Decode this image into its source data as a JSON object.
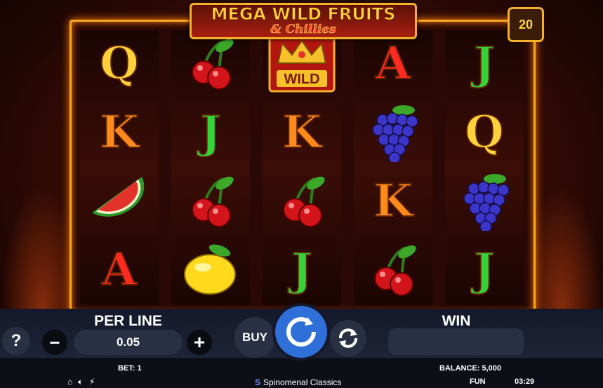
{
  "game": {
    "title_line1": "MEGA WILD FRUITS",
    "title_line2": "& Chillies",
    "lines_count": "20"
  },
  "reels": [
    [
      "Q",
      "K",
      "watermelon",
      "A"
    ],
    [
      "cherry",
      "J",
      "cherry",
      "lemon"
    ],
    [
      "wild",
      "K",
      "cherry",
      "J"
    ],
    [
      "A",
      "grapes",
      "K",
      "cherry"
    ],
    [
      "J",
      "Q",
      "grapes",
      "J"
    ]
  ],
  "wild_label": "WILD",
  "controls": {
    "help_label": "?",
    "minus_label": "−",
    "plus_label": "+",
    "per_line_label": "PER LINE",
    "per_line_value": "0.05",
    "buy_label": "BUY",
    "win_label": "WIN",
    "win_value": ""
  },
  "footer": {
    "bet": "BET: 1",
    "balance": "BALANCE: 5,000",
    "mode": "FUN",
    "time": "03:29",
    "provider": "Spinomenal Classics",
    "icons": [
      "home-icon",
      "sound-icon",
      "turbo-icon"
    ]
  },
  "colors": {
    "frame": "#f5a623",
    "panel": "#1f2538",
    "spin_button": "#2e6fd8"
  }
}
